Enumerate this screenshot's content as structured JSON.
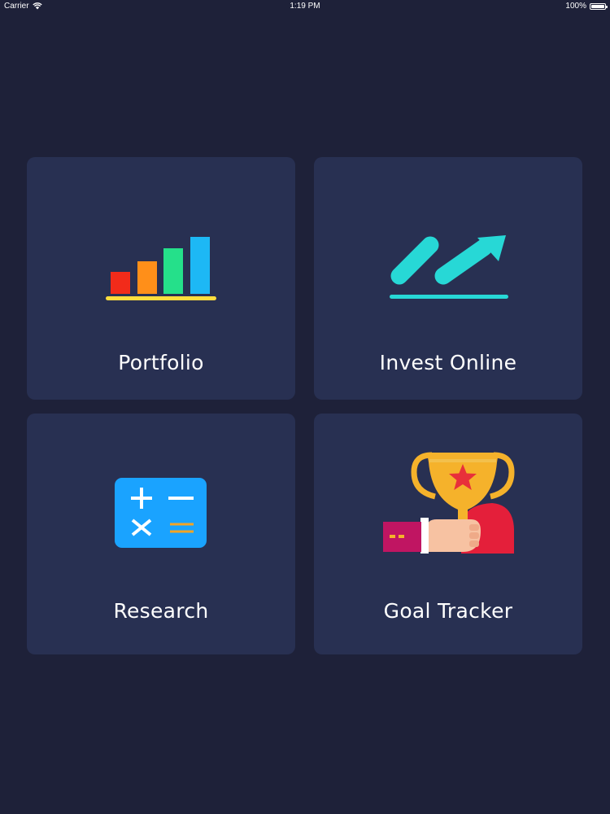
{
  "status_bar": {
    "carrier": "Carrier",
    "time": "1:19 PM",
    "battery": "100%",
    "battery_level": 1.0
  },
  "tiles": [
    {
      "label": "Portfolio",
      "icon": "bar-chart-icon"
    },
    {
      "label": "Invest Online",
      "icon": "trend-arrow-icon"
    },
    {
      "label": "Research",
      "icon": "calculator-icon"
    },
    {
      "label": "Goal Tracker",
      "icon": "trophy-icon"
    }
  ],
  "colors": {
    "background": "#1e2139",
    "tile": "#283052",
    "text": "#ffffff",
    "bar_red": "#f22b1a",
    "bar_orange": "#ff8f19",
    "bar_green": "#25e08a",
    "bar_blue": "#1db8f5",
    "baseline_yellow": "#ffdd3d",
    "invest_teal": "#27d8d6",
    "calculator_blue": "#1aa3ff",
    "trophy_gold": "#f5b22b",
    "star_red": "#e8303a",
    "shirt_red": "#e41f3a",
    "sleeve_magenta": "#c01562"
  }
}
